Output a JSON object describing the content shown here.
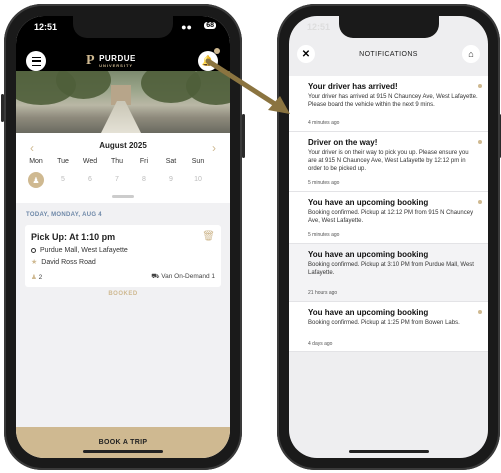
{
  "colors": {
    "accent": "#cfb991",
    "dark": "#000000",
    "link_blue": "#6e88a8"
  },
  "phone1": {
    "status_time": "12:51",
    "battery": "68",
    "brand": "PURDUE",
    "brand_sub": "UNIVERSITY",
    "calendar": {
      "month": "August 2025",
      "days": [
        {
          "dow": "Mon",
          "dom": ""
        },
        {
          "dow": "Tue",
          "dom": "5"
        },
        {
          "dow": "Wed",
          "dom": "6"
        },
        {
          "dow": "Thu",
          "dom": "7"
        },
        {
          "dow": "Fri",
          "dom": "8"
        },
        {
          "dow": "Sat",
          "dom": "9"
        },
        {
          "dow": "Sun",
          "dom": "10"
        }
      ],
      "selected_icon": "person-icon"
    },
    "date_label": "TODAY, MONDAY, AUG 4",
    "trip": {
      "title": "Pick Up: At 1:10 pm",
      "origin": "Purdue Mall, West Lafayette",
      "destination": "David Ross Road",
      "passengers": "2",
      "service": "Van On-Demand 1",
      "status": "BOOKED"
    },
    "book_button": "BOOK A TRIP"
  },
  "phone2": {
    "status_time": "12:51",
    "title": "NOTIFICATIONS",
    "notifications": [
      {
        "heading": "Your driver has arrived!",
        "body": "Your driver has arrived at 915 N Chauncey Ave, West Lafayette. Please board the vehicle within the next 9 mins.",
        "time": "4 minutes ago",
        "unread": true
      },
      {
        "heading": "Driver on the way!",
        "body": "Your driver is on their way to pick you up. Please ensure you are at 915 N Chauncey Ave, West Lafayette by 12:12 pm in order to be picked up.",
        "time": "5 minutes ago",
        "unread": true
      },
      {
        "heading": "You have an upcoming booking",
        "body": "Booking confirmed. Pickup at 12:12 PM from 915 N Chauncey Ave, West Lafayette.",
        "time": "5 minutes ago",
        "unread": true
      },
      {
        "heading": "You have an upcoming booking",
        "body": "Booking confirmed. Pickup at 3:10 PM from Purdue Mall, West Lafayette.",
        "time": "21 hours ago",
        "unread": false
      },
      {
        "heading": "You have an upcoming booking",
        "body": "Booking confirmed. Pickup at 1:25 PM from Bowen Labs.",
        "time": "4 days ago",
        "unread": true
      }
    ]
  }
}
